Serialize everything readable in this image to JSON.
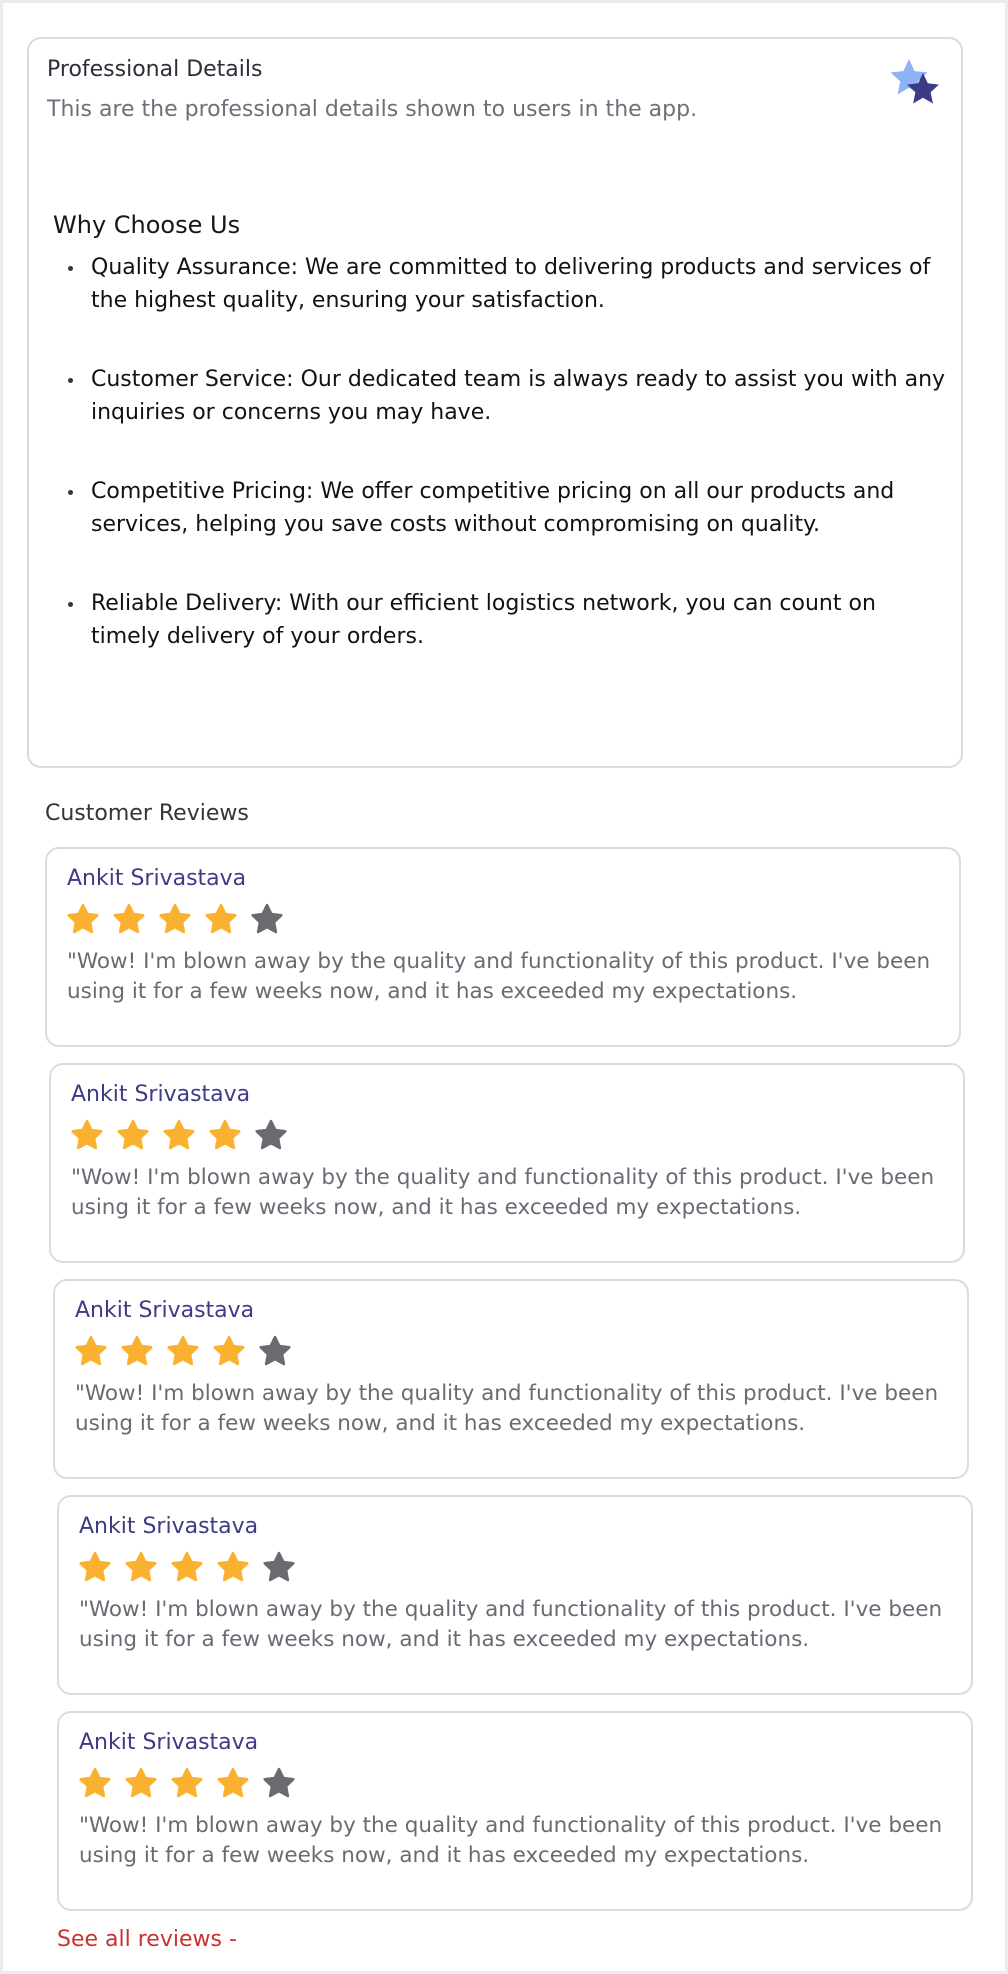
{
  "professional_details": {
    "title": "Professional Details",
    "subtitle": "This are the professional details shown to users in the app.",
    "badge_icon": "stars-badge-icon",
    "why_title": "Why Choose Us",
    "why_items": [
      {
        "text": "Quality Assurance: We are committed to delivering products and services of the highest quality, ensuring your satisfaction."
      },
      {
        "text": "Customer Service: Our dedicated team is always ready to assist you with any inquiries or concerns you may have."
      },
      {
        "text": "Competitive Pricing: We offer competitive pricing on all our products and services, helping you save costs without compromising on quality."
      },
      {
        "text": "Reliable Delivery: With our efficient logistics network, you can count on timely delivery of your orders."
      }
    ]
  },
  "reviews": {
    "title": "Customer Reviews",
    "items": [
      {
        "name": "Ankit Srivastava",
        "rating": 4,
        "max_rating": 5,
        "text": "\"Wow! I'm blown away by the quality and functionality of this product. I've been using it for a few weeks now, and it has exceeded my expectations."
      },
      {
        "name": "Ankit Srivastava",
        "rating": 4,
        "max_rating": 5,
        "text": "\"Wow! I'm blown away by the quality and functionality of this product. I've been using it for a few weeks now, and it has exceeded my expectations."
      },
      {
        "name": "Ankit Srivastava",
        "rating": 4,
        "max_rating": 5,
        "text": "\"Wow! I'm blown away by the quality and functionality of this product. I've been using it for a few weeks now, and it has exceeded my expectations."
      },
      {
        "name": "Ankit Srivastava",
        "rating": 4,
        "max_rating": 5,
        "text": "\"Wow! I'm blown away by the quality and functionality of this product. I've been using it for a few weeks now, and it has exceeded my expectations."
      },
      {
        "name": "Ankit Srivastava",
        "rating": 4,
        "max_rating": 5,
        "text": "\"Wow! I'm blown away by the quality and functionality of this product. I've been using it for a few weeks now, and it has exceeded my expectations."
      }
    ],
    "see_all_label": "See all reviews -"
  },
  "colors": {
    "star_filled": "#fbb130",
    "star_empty": "#6a6a70",
    "reviewer_name": "#3d3a86",
    "link": "#cc3030",
    "badge_light": "#8fb4f5",
    "badge_dark": "#3d3a86"
  }
}
